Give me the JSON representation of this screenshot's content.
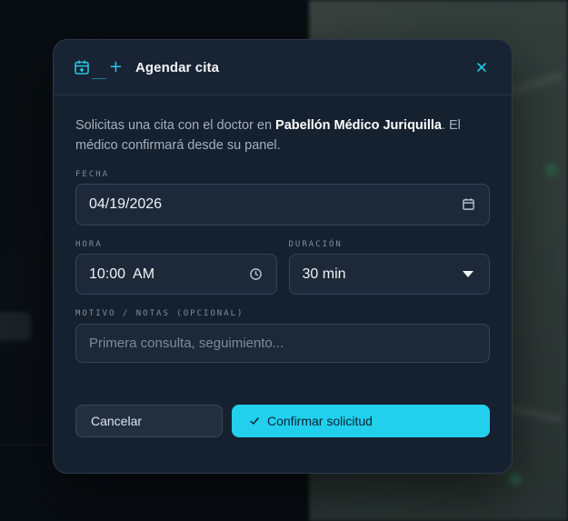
{
  "modal": {
    "title": "Agendar cita",
    "header_icon": "calendar-plus-icon",
    "close_icon": "close-icon",
    "intro_before": "Solicitas una cita con el doctor en ",
    "intro_place": "Pabellón Médico Juriquilla",
    "intro_after": ". El médico confirmará desde su panel."
  },
  "form": {
    "fecha": {
      "label": "FECHA",
      "value": "04/19/2026",
      "icon": "calendar-icon"
    },
    "hora": {
      "label": "HORA",
      "value": "10:00  AM",
      "icon": "clock-icon"
    },
    "duracion": {
      "label": "DURACIÓN",
      "value": "30 min",
      "icon": "caret-down-icon"
    },
    "motivo": {
      "label": "MOTIVO / NOTAS (OPCIONAL)",
      "placeholder": "Primera consulta, seguimiento..."
    }
  },
  "actions": {
    "cancel_label": "Cancelar",
    "confirm_label": "Confirmar solicitud",
    "confirm_icon": "check-icon"
  },
  "colors": {
    "accent": "#22d0ee",
    "modal_bg": "#162130",
    "field_bg": "#1d2939"
  }
}
